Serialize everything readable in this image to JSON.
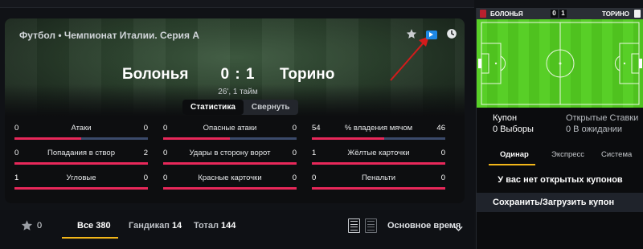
{
  "match": {
    "breadcrumb": "Футбол • Чемпионат Италии. Серия А",
    "home_team": "Болонья",
    "away_team": "Торино",
    "score": "0 : 1",
    "time": "26', 1 тайм",
    "toggle": {
      "stats_label": "Статистика",
      "collapse_label": "Свернуть"
    },
    "icons": [
      "star-icon",
      "tv-icon",
      "clock-icon"
    ]
  },
  "stats": [
    {
      "label": "Атаки",
      "home": "0",
      "away": "0",
      "home_share": 0.5
    },
    {
      "label": "Опасные атаки",
      "home": "0",
      "away": "0",
      "home_share": 0.5
    },
    {
      "label": "% владения мячом",
      "home": "54",
      "away": "46",
      "home_share": 0.54
    },
    {
      "label": "Попадания в створ",
      "home": "0",
      "away": "2",
      "home_share": 0.0
    },
    {
      "label": "Удары в сторону ворот",
      "home": "0",
      "away": "0",
      "home_share": 0.0
    },
    {
      "label": "Жёлтые карточки",
      "home": "1",
      "away": "0",
      "home_share": 1.0
    },
    {
      "label": "Угловые",
      "home": "1",
      "away": "0",
      "home_share": 1.0
    },
    {
      "label": "Красные карточки",
      "home": "0",
      "away": "0",
      "home_share": 0.0
    },
    {
      "label": "Пенальти",
      "home": "0",
      "away": "0",
      "home_share": 0.0
    }
  ],
  "markets": {
    "favorites_count": "0",
    "tabs": [
      {
        "label": "Все",
        "count": "380"
      },
      {
        "label": "Гандикап",
        "count": "14"
      },
      {
        "label": "Тотал",
        "count": "144"
      }
    ],
    "time_filter": "Основное время"
  },
  "field": {
    "home_team": "БОЛОНЬЯ",
    "away_team": "ТОРИНО",
    "home_score": "0",
    "away_score": "1"
  },
  "coupon": {
    "title": "Купон",
    "selections": "0 Выборы",
    "open_title": "Открытые Ставки",
    "open_sub": "0 В ожидании",
    "tabs": [
      "Одинар",
      "Экспресс",
      "Система"
    ],
    "empty_text": "У вас нет открытых купонов",
    "save_button": "Сохранить/Загрузить купон"
  },
  "colors": {
    "accent": "#f2b619",
    "stat_bar_highlight": "#e8285a",
    "stat_bar_base": "#3b4a6b",
    "tv_icon": "#1e88e5",
    "pitch": "#4fc21f"
  }
}
